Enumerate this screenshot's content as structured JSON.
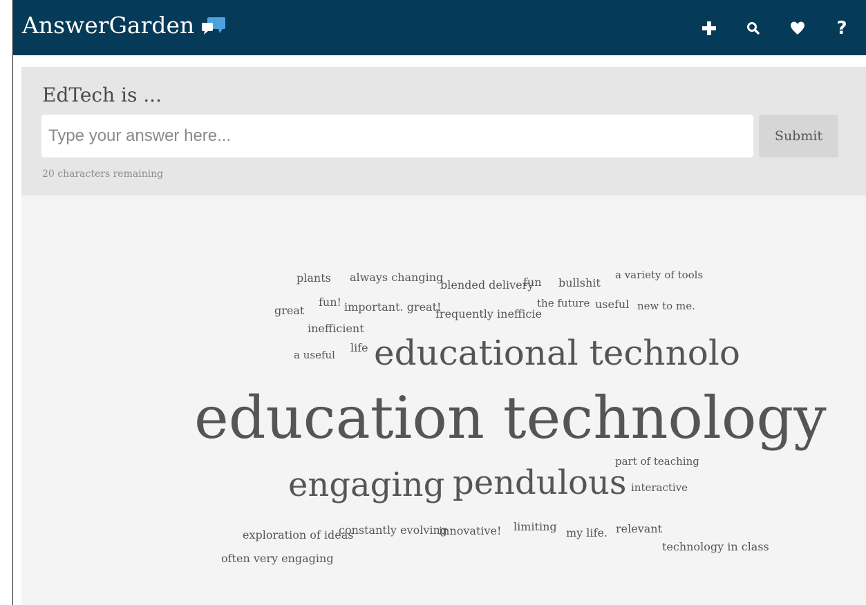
{
  "app": {
    "title": "AnswerGarden",
    "brand_color": "#053a58",
    "logo_icon": "speech-bubbles-icon",
    "logo_icon_color": "#4aa3df"
  },
  "nav": {
    "icons": [
      "plus-icon",
      "search-icon",
      "heart-icon",
      "help-icon"
    ],
    "help_glyph": "?"
  },
  "question": {
    "title": "EdTech is ..."
  },
  "answer_form": {
    "placeholder": "Type your answer here...",
    "value": "",
    "submit_label": "Submit",
    "remaining_text": "20 characters remaining"
  },
  "cloud": {
    "words": [
      {
        "text": "plants"
      },
      {
        "text": "always changing"
      },
      {
        "text": "blended delivery"
      },
      {
        "text": "fun"
      },
      {
        "text": "bullshit"
      },
      {
        "text": "a variety of tools"
      },
      {
        "text": "great"
      },
      {
        "text": "fun!"
      },
      {
        "text": "important. great!"
      },
      {
        "text": "frequently inefficie"
      },
      {
        "text": "the future"
      },
      {
        "text": "useful"
      },
      {
        "text": "new to me."
      },
      {
        "text": "inefficient"
      },
      {
        "text": "a useful"
      },
      {
        "text": "life"
      },
      {
        "text": "educational technolo"
      },
      {
        "text": "education technology"
      },
      {
        "text": "part of teaching"
      },
      {
        "text": "engaging"
      },
      {
        "text": "pendulous"
      },
      {
        "text": "interactive"
      },
      {
        "text": "exploration of ideas"
      },
      {
        "text": "constantly evolving"
      },
      {
        "text": "innovative!"
      },
      {
        "text": "limiting"
      },
      {
        "text": "my life."
      },
      {
        "text": "relevant"
      },
      {
        "text": "technology in class"
      },
      {
        "text": "often very engaging"
      }
    ]
  }
}
